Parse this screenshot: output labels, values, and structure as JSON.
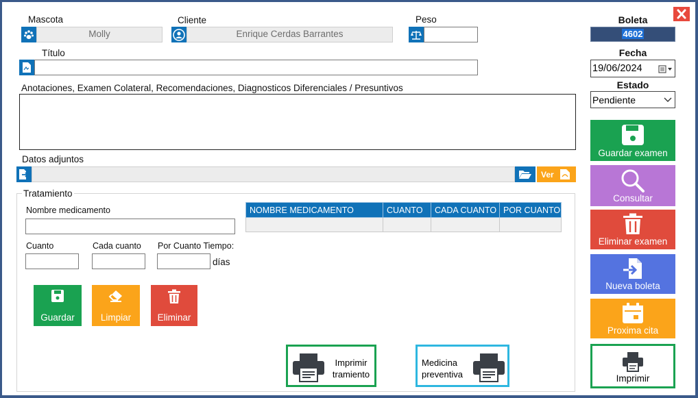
{
  "header": {
    "mascota_label": "Mascota",
    "mascota_value": "Molly",
    "cliente_label": "Cliente",
    "cliente_value": "Enrique Cerdas Barrantes",
    "peso_label": "Peso",
    "peso_value": "",
    "titulo_label": "Título",
    "titulo_value": ""
  },
  "notes": {
    "label": "Anotaciones, Examen Colateral, Recomendaciones, Diagnosticos Diferenciales / Presuntivos",
    "value": ""
  },
  "attachments": {
    "label": "Datos adjuntos",
    "value": "",
    "ver_label": "Ver"
  },
  "treatment": {
    "group_label": "Tratamiento",
    "nombre_label": "Nombre medicamento",
    "cuanto_label": "Cuanto",
    "cada_label": "Cada cuanto",
    "por_label": "Por Cuanto Tiempo:",
    "dias_label": "días",
    "guardar_label": "Guardar",
    "limpiar_label": "Limpiar",
    "eliminar_label": "Eliminar",
    "columns": [
      "NOMBRE MEDICAMENTO",
      "CUANTO",
      "CADA CUANTO",
      "POR CUANTO"
    ]
  },
  "print": {
    "tratamiento_label": "Imprimir tramiento",
    "preventiva_label": "Medicina preventiva"
  },
  "sidebar": {
    "boleta_label": "Boleta",
    "boleta_value": "4602",
    "fecha_label": "Fecha",
    "fecha_value": "19/06/2024",
    "estado_label": "Estado",
    "estado_value": "Pendiente",
    "guardar_examen": "Guardar examen",
    "consultar": "Consultar",
    "eliminar_examen": "Eliminar examen",
    "nueva_boleta": "Nueva boleta",
    "proxima_cita": "Proxima cita",
    "imprimir": "Imprimir"
  },
  "colors": {
    "blue": "#1072b8",
    "green": "#1aa251",
    "purple": "#b876d6",
    "red": "#e04b3c",
    "royal": "#5473e0",
    "orange": "#fba41a",
    "close": "#e8493d",
    "cyan": "#2eb7e0"
  }
}
